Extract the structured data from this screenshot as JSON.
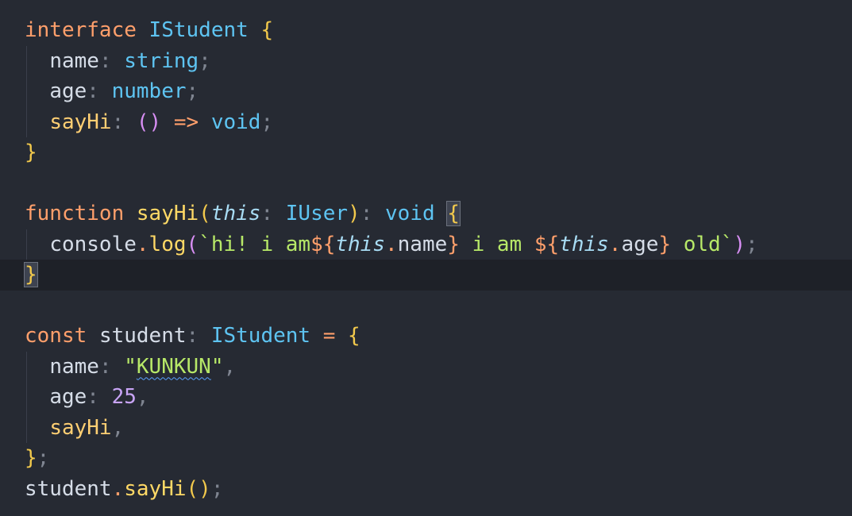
{
  "code": {
    "l1": {
      "kw": "interface",
      "name": "IStudent",
      "brace": "{"
    },
    "l2": {
      "prop": "name",
      "colon": ":",
      "type": "string",
      "semi": ";"
    },
    "l3": {
      "prop": "age",
      "colon": ":",
      "type": "number",
      "semi": ";"
    },
    "l4": {
      "prop": "sayHi",
      "colon": ":",
      "parens": "()",
      "arrow": "=>",
      "type": "void",
      "semi": ";"
    },
    "l5": {
      "brace": "}"
    },
    "l7": {
      "kw": "function",
      "fn": "sayHi",
      "lparen": "(",
      "this": "this",
      "colon": ":",
      "type": "IUser",
      "rparen": ")",
      "colon2": ":",
      "ret": "void",
      "brace": "{"
    },
    "l8": {
      "obj": "console",
      "dot": ".",
      "method": "log",
      "lparen": "(",
      "tpl_open": "`hi! i am",
      "interp1_open": "${",
      "this1": "this",
      "dot1": ".",
      "p1": "name",
      "interp1_close": "}",
      "tpl_mid": " i am ",
      "interp2_open": "${",
      "this2": "this",
      "dot2": ".",
      "p2": "age",
      "interp2_close": "}",
      "tpl_close": " old`",
      "rparen": ")",
      "semi": ";"
    },
    "l9": {
      "brace": "}"
    },
    "l11": {
      "kw": "const",
      "var": "student",
      "colon": ":",
      "type": "IStudent",
      "eq": "=",
      "brace": "{"
    },
    "l12": {
      "prop": "name",
      "colon": ":",
      "q1": "\"",
      "str": "KUNKUN",
      "q2": "\"",
      "comma": ","
    },
    "l13": {
      "prop": "age",
      "colon": ":",
      "num": "25",
      "comma": ","
    },
    "l14": {
      "prop": "sayHi",
      "comma": ","
    },
    "l15": {
      "brace": "}",
      "semi": ";"
    },
    "l16": {
      "obj": "student",
      "dot": ".",
      "method": "sayHi",
      "parens": "()",
      "semi": ";"
    }
  },
  "colors": {
    "background": "#262a33",
    "keyword": "#ff9f6b",
    "type": "#5ec4f2",
    "function": "#ffd966",
    "string": "#b7e868",
    "number": "#c8a4f6",
    "brace": "#f2c94c"
  }
}
